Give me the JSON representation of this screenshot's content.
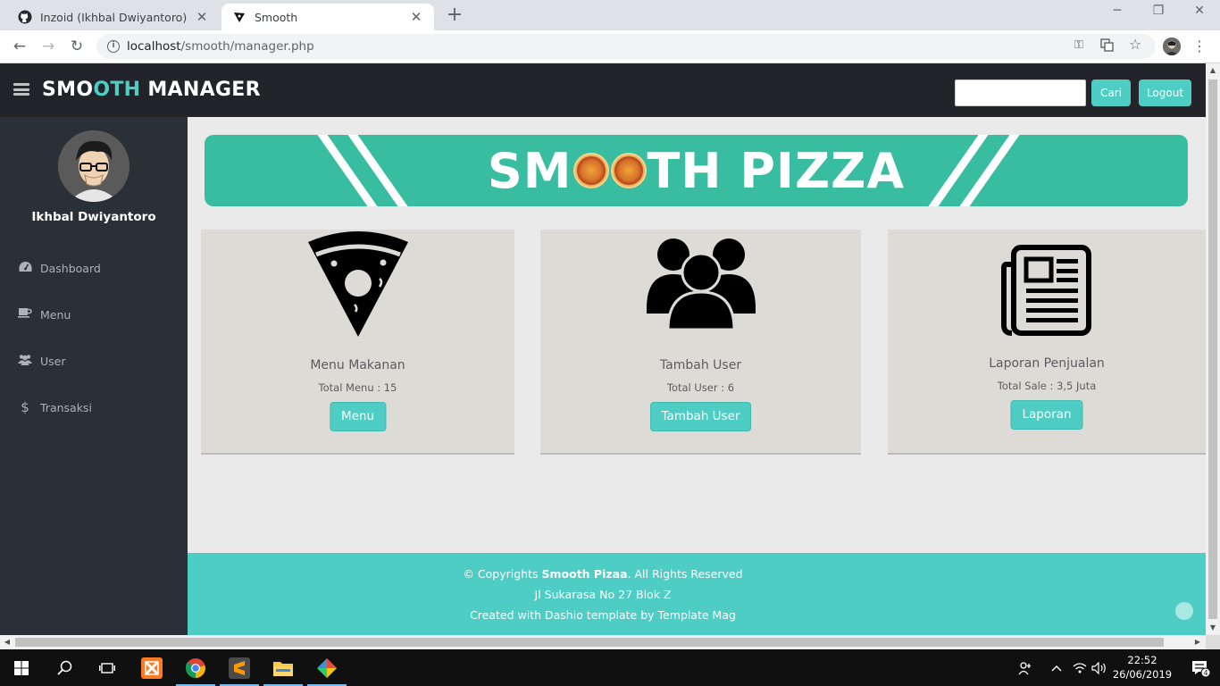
{
  "browser": {
    "tabs": [
      {
        "title": "Inzoid (Ikhbal Dwiyantoro)",
        "icon": "github-icon"
      },
      {
        "title": "Smooth",
        "icon": "smooth-favicon-icon"
      }
    ],
    "url_host": "localhost",
    "url_path": "/smooth/manager.php"
  },
  "header": {
    "logo_part1": "SMO",
    "logo_accent": "OTH",
    "logo_part2": " MANAGER",
    "search_placeholder": "",
    "search_button": "Cari",
    "logout_button": "Logout"
  },
  "sidebar": {
    "username": "Ikhbal Dwiyantoro",
    "items": [
      {
        "label": "Dashboard",
        "icon": "dashboard-icon"
      },
      {
        "label": "Menu",
        "icon": "coffee-icon"
      },
      {
        "label": "User",
        "icon": "users-icon"
      },
      {
        "label": "Transaksi",
        "icon": "dollar-icon"
      }
    ]
  },
  "banner": {
    "part1": "SM",
    "part2": "TH PIZZA"
  },
  "cards": [
    {
      "title": "Menu Makanan",
      "subtitle": "Total Menu : 15",
      "button": "Menu",
      "icon": "pizza-slice-icon"
    },
    {
      "title": "Tambah User",
      "subtitle": "Total User : 6",
      "button": "Tambah User",
      "icon": "users-group-icon"
    },
    {
      "title": "Laporan Penjualan",
      "subtitle": "Total Sale : 3,5 Juta",
      "button": "Laporan",
      "icon": "newspaper-icon"
    }
  ],
  "footer": {
    "copyright_prefix": "© Copyrights ",
    "brand": "Smooth Pizaa",
    "copyright_suffix": ". All Rights Reserved",
    "address": "Jl Sukarasa No 27 Blok Z",
    "credit": "Created with Dashio template by Template Mag"
  },
  "taskbar": {
    "time": "22:52",
    "date": "26/06/2019",
    "notification_count": "4"
  },
  "colors": {
    "accent": "#4ecdc4",
    "header_bg": "#22242a",
    "sidebar_bg": "#2a3038",
    "banner_bg": "#38bda1"
  }
}
